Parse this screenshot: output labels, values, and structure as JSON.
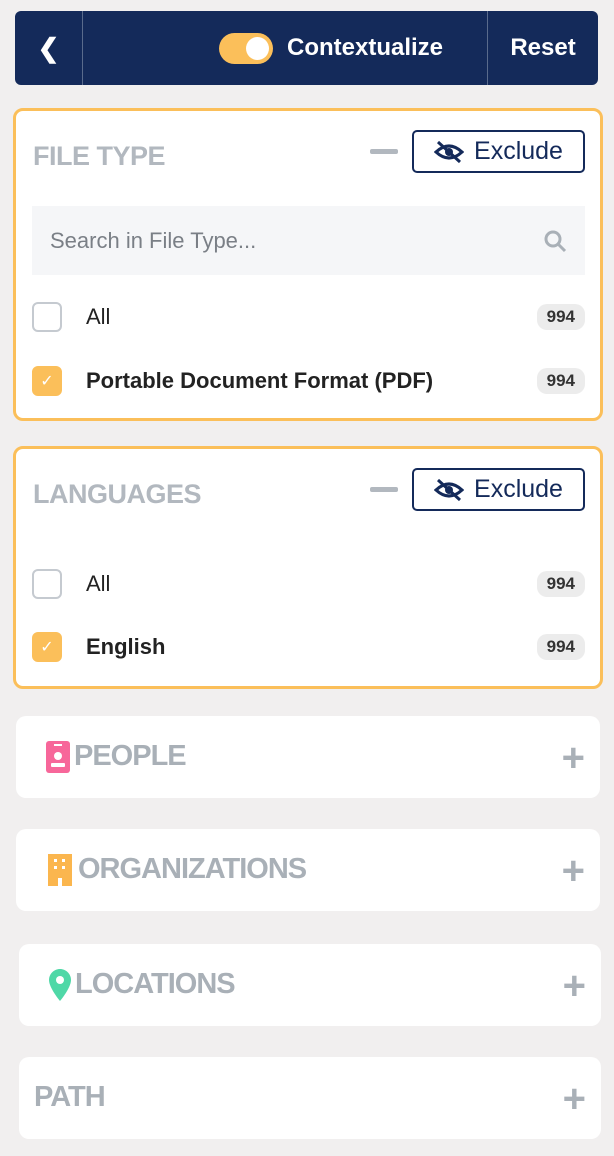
{
  "header": {
    "back_icon": "chevron-left-icon",
    "contextualize_label": "Contextualize",
    "contextualize_on": true,
    "reset_label": "Reset"
  },
  "colors": {
    "header": "#142a5a",
    "accent": "#fbbf5a"
  },
  "file_type": {
    "title": "FILE TYPE",
    "exclude_label": "Exclude",
    "search_placeholder": "Search in File Type...",
    "items": [
      {
        "label": "All",
        "count": "994",
        "checked": false
      },
      {
        "label": "Portable Document Format (PDF)",
        "count": "994",
        "checked": true
      }
    ]
  },
  "languages": {
    "title": "LANGUAGES",
    "exclude_label": "Exclude",
    "items": [
      {
        "label": "All",
        "count": "994",
        "checked": false
      },
      {
        "label": "English",
        "count": "994",
        "checked": true
      }
    ]
  },
  "collapsed": [
    {
      "title": "PEOPLE",
      "icon": "person-badge-icon"
    },
    {
      "title": "ORGANIZATIONS",
      "icon": "building-icon"
    },
    {
      "title": "LOCATIONS",
      "icon": "map-pin-icon"
    },
    {
      "title": "PATH"
    }
  ]
}
